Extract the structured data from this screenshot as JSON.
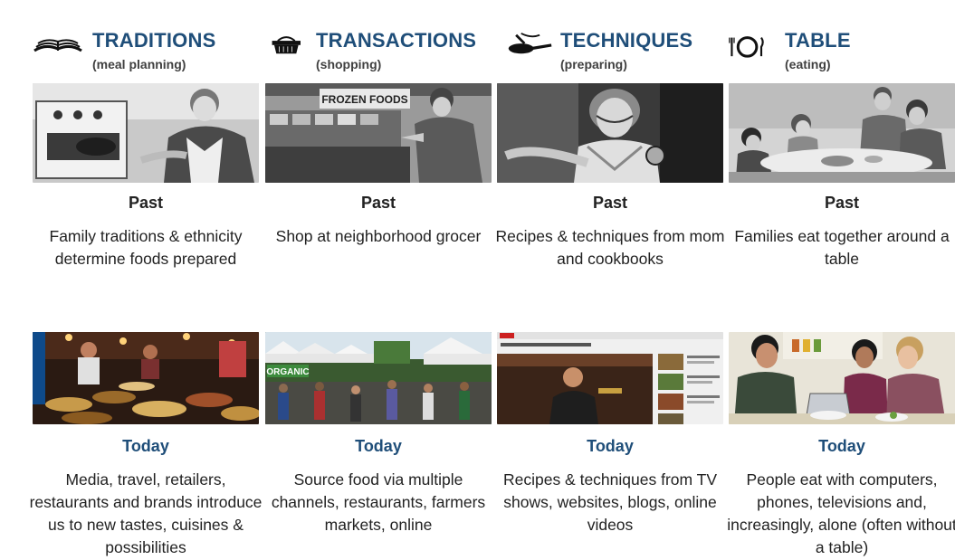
{
  "columns": [
    {
      "title": "TRADITIONS",
      "subtitle": "(meal planning)",
      "icon": "open-book-icon",
      "past_label": "Past",
      "past_text": "Family traditions & ethnicity determine foods prepared",
      "today_label": "Today",
      "today_text": "Media, travel, retailers, restaurants and brands introduce us to new tastes, cuisines & possibilities"
    },
    {
      "title": "TRANSACTIONS",
      "subtitle": "(shopping)",
      "icon": "shopping-basket-icon",
      "past_label": "Past",
      "past_text": "Shop at neighborhood grocer",
      "past_photo_sign": "FROZEN FOODS",
      "today_label": "Today",
      "today_text": "Source food via multiple channels, restaurants, farmers markets, online",
      "today_photo_sign": "ORGANIC"
    },
    {
      "title": "TECHNIQUES",
      "subtitle": "(preparing)",
      "icon": "frying-pan-icon",
      "past_label": "Past",
      "past_text": "Recipes & techniques from mom and cookbooks",
      "today_label": "Today",
      "today_text": "Recipes & techniques from TV shows, websites, blogs, online videos"
    },
    {
      "title": "TABLE",
      "subtitle": "(eating)",
      "icon": "plate-and-cutlery-icon",
      "past_label": "Past",
      "past_text": "Families eat together around a table",
      "today_label": "Today",
      "today_text": "People eat with computers, phones, televisions and, increasingly, alone (often without a table)"
    }
  ],
  "colors": {
    "title": "#1f4e79",
    "today_label": "#1f4e79",
    "body_text": "#222222"
  }
}
